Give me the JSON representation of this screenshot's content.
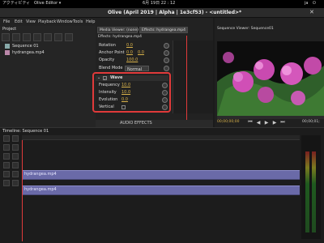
{
  "system": {
    "activities": "アクティビティ",
    "app_menu": "Olive Editor ▾",
    "clock": "6月 19日  22 : 12",
    "user": "ja"
  },
  "window": {
    "title": "Olive (April 2019 | Alpha | 1e3cf53) - <untitled>*"
  },
  "menu": {
    "items": [
      "File",
      "Edit",
      "View",
      "Playback",
      "Window",
      "Tools",
      "Help"
    ]
  },
  "project": {
    "label": "Project",
    "items": [
      {
        "name": "Sequence 01",
        "icon": "sequence-icon"
      },
      {
        "name": "hydrangea.mp4",
        "icon": "video-file-icon"
      }
    ]
  },
  "effects": {
    "tab_media": "Media Viewer: (none)",
    "tab_effects": "Effects: hydrangea.mp4",
    "header": "Effects: hydrangea.mp4",
    "transform_rows": [
      {
        "label": "Rotation",
        "values": [
          "0.0"
        ]
      },
      {
        "label": "Anchor Point",
        "values": [
          "0.0",
          "0.0"
        ]
      },
      {
        "label": "Opacity",
        "values": [
          "100.0"
        ]
      }
    ],
    "blend_label": "Blend Mode",
    "blend_value": "Normal",
    "wave_title": "Wave",
    "wave_rows": [
      {
        "label": "Frequency",
        "value": "10.0"
      },
      {
        "label": "Intensity",
        "value": "10.0"
      },
      {
        "label": "Evolution",
        "value": "0.0"
      },
      {
        "label": "Vertical",
        "value": ""
      }
    ],
    "footer": "AUDIO EFFECTS"
  },
  "viewer": {
    "title": "Sequence Viewer: Sequence01",
    "timecode_left": "00;00;00;00",
    "timecode_right": "00;00;01;"
  },
  "timeline": {
    "title": "Timeline: Sequence 01",
    "clips": [
      {
        "label": "hydrangea.mp4"
      },
      {
        "label": "hydrangea.mp4"
      }
    ]
  },
  "colors": {
    "accent_red": "#e03a3a",
    "clip": "#6a6aa8",
    "value": "#d9b24a"
  }
}
